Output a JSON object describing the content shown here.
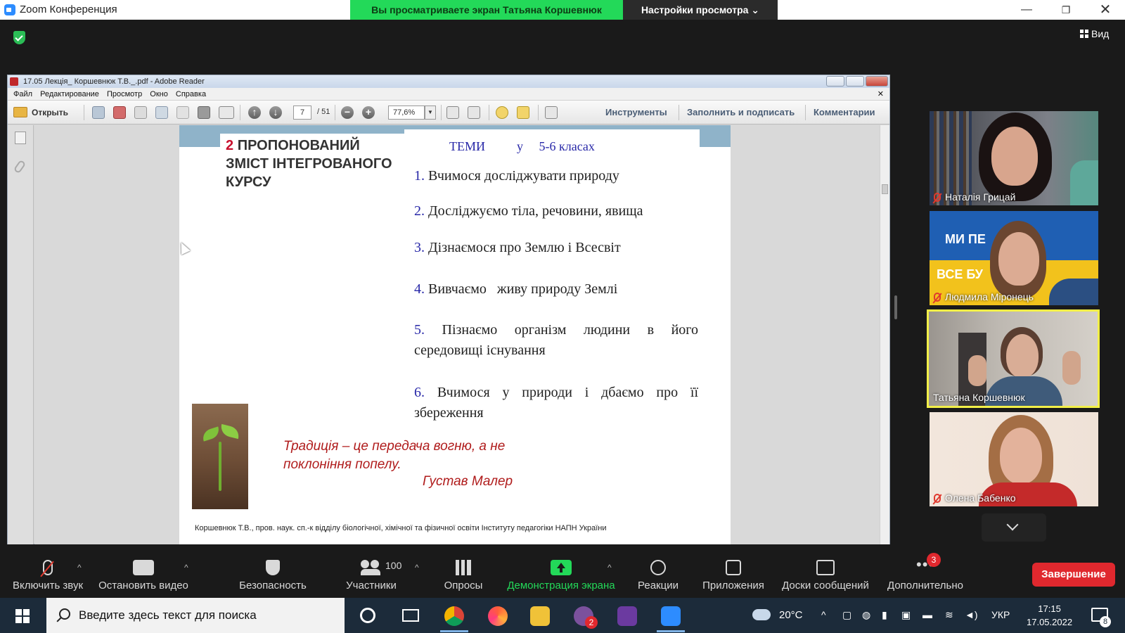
{
  "zoom": {
    "window_title": "Zoom Конференция",
    "share_banner": "Вы просматриваете экран Татьяна Коршевнюк",
    "view_settings": "Настройки просмотра ⌄",
    "view_label": "Вид"
  },
  "reader": {
    "window_title": "17.05 Лекція_ Коршевнюк Т.В._.pdf - Adobe Reader",
    "menu": [
      "Файл",
      "Редактирование",
      "Просмотр",
      "Окно",
      "Справка"
    ],
    "open_label": "Открыть",
    "page_current": "7",
    "page_total": "/ 51",
    "zoom_value": "77,6%",
    "tools_label": "Инструменты",
    "fill_sign_label": "Заполнить и подписать",
    "comments_label": "Комментарии"
  },
  "slide": {
    "section_number": "2",
    "section_title": "ПРОПОНОВАНИЙ ЗМІСТ ІНТЕГРОВАНОГО КУРСУ",
    "topics_heading": "ТЕМИ          у     5-6 класах",
    "topics": [
      {
        "num": "1.",
        "text": "Вчимося досліджувати природу"
      },
      {
        "num": "2.",
        "text": "Досліджуємо тіла, речовини, явища"
      },
      {
        "num": "3.",
        "text": "Дізнаємося про Землю і Всесвіт"
      },
      {
        "num": "4.",
        "text": "Вивчаємо   живу природу Землі"
      },
      {
        "num": "5.",
        "text": "Пізнаємо організм людини в його середовищі існування"
      },
      {
        "num": "6.",
        "text": "Вчимося у природи і дбаємо про її збереження"
      }
    ],
    "quote": "Традиція – це передача вогню, а не поклоніння попелу.",
    "quote_author": "Густав Малер",
    "footer": "Коршевнюк Т.В., пров. наук. сп.-к відділу біологічної, хімічної та фізичної освіти Інституту педагогіки НАПН України"
  },
  "participants": [
    {
      "name": "Наталія Грицай",
      "muted": true
    },
    {
      "name": "Людмила Міронець",
      "muted": true,
      "banner_top": "МИ ПЕ      ЕМО!",
      "banner_bottom": "ВСЕ БУ      АЇНА!"
    },
    {
      "name": "Татьяна Коршевнюк",
      "muted": false,
      "active": true
    },
    {
      "name": "Олена Бабенко",
      "muted": true
    }
  ],
  "toolbar": {
    "unmute": "Включить звук",
    "stop_video": "Остановить видео",
    "security": "Безопасность",
    "participants": "Участники",
    "participants_count": "100",
    "polls": "Опросы",
    "share_screen": "Демонстрация экрана",
    "reactions": "Реакции",
    "apps": "Приложения",
    "whiteboards": "Доски сообщений",
    "more": "Дополнительно",
    "more_badge": "3",
    "end": "Завершение"
  },
  "taskbar": {
    "search_placeholder": "Введите здесь текст для поиска",
    "viber_badge": "2",
    "weather": "20°C",
    "language": "УКР",
    "time": "17:15",
    "date": "17.05.2022",
    "notification_count": "8"
  },
  "colors": {
    "share_green": "#23d959",
    "end_red": "#e0282e",
    "active_speaker": "#f2ef48",
    "topic_blue": "#2828a8",
    "quote_red": "#b01c1c"
  }
}
